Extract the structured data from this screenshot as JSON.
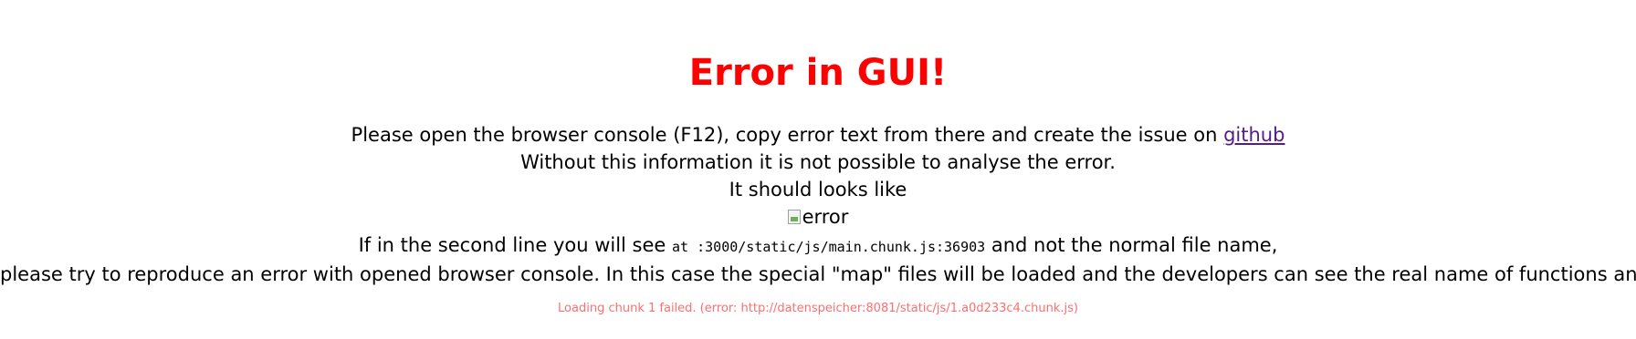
{
  "title": "Error in GUI!",
  "message": {
    "line1_text": "Please open the browser console (F12), copy error text from there and create the issue on ",
    "github_link_text": "github",
    "line2": "Without this information it is not possible to analyse the error.",
    "line3": "It should looks like",
    "image_alt": "error",
    "line5_before": "If in the second line you will see ",
    "line5_code": "at :3000/static/js/main.chunk.js:36903",
    "line5_after": " and not the normal file name,",
    "line6": "please try to reproduce an error with opened browser console. In this case the special \"map\" files will be loaded and the developers can see the real name of functions and files."
  },
  "error_detail": "Loading chunk 1 failed. (error: http://datenspeicher:8081/static/js/1.a0d233c4.chunk.js)",
  "colors": {
    "title": "#ff0000",
    "link": "#551a8b",
    "error_detail": "#ff6e6e"
  }
}
